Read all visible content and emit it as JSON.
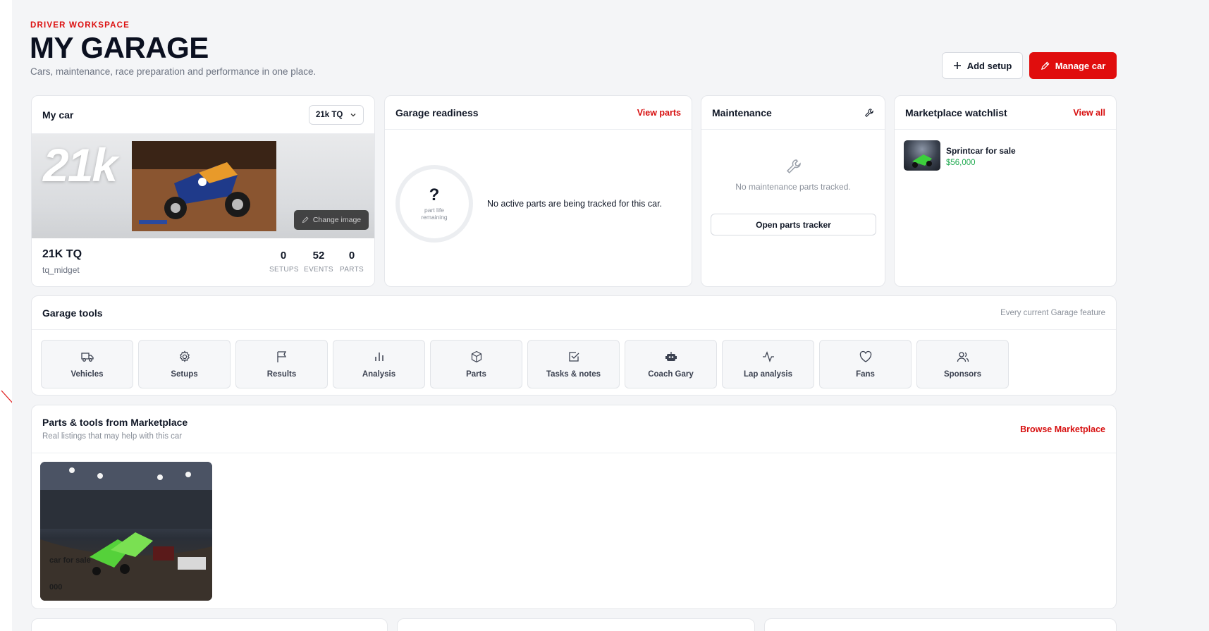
{
  "header": {
    "eyebrow": "DRIVER WORKSPACE",
    "title": "MY GARAGE",
    "subtitle": "Cars, maintenance, race preparation and performance in one place."
  },
  "actions": {
    "add_setup": "Add setup",
    "manage_car": "Manage car"
  },
  "my_car": {
    "title": "My car",
    "selected_car": "21k TQ",
    "hero_text": "21k",
    "change_image": "Change image",
    "name": "21K TQ",
    "slug": "tq_midget",
    "stats": [
      {
        "value": "0",
        "label": "SETUPS"
      },
      {
        "value": "52",
        "label": "EVENTS"
      },
      {
        "value": "0",
        "label": "PARTS"
      }
    ]
  },
  "readiness": {
    "title": "Garage readiness",
    "link": "View parts",
    "ring_value": "?",
    "ring_label_line1": "part life",
    "ring_label_line2": "remaining",
    "message": "No active parts are being tracked for this car."
  },
  "maintenance": {
    "title": "Maintenance",
    "empty_message": "No maintenance parts tracked.",
    "button": "Open parts tracker"
  },
  "watchlist": {
    "title": "Marketplace watchlist",
    "link": "View all",
    "item_name": "Sprintcar for sale",
    "item_price": "$56,000"
  },
  "tools": {
    "title": "Garage tools",
    "note": "Every current Garage feature",
    "items": [
      {
        "label": "Vehicles",
        "icon": "truck-icon"
      },
      {
        "label": "Setups",
        "icon": "gear-icon"
      },
      {
        "label": "Results",
        "icon": "flag-icon"
      },
      {
        "label": "Analysis",
        "icon": "bar-chart-icon"
      },
      {
        "label": "Parts",
        "icon": "package-icon"
      },
      {
        "label": "Tasks & notes",
        "icon": "checkbox-icon"
      },
      {
        "label": "Coach Gary",
        "icon": "robot-icon"
      },
      {
        "label": "Lap analysis",
        "icon": "activity-icon"
      },
      {
        "label": "Fans",
        "icon": "heart-icon"
      },
      {
        "label": "Sponsors",
        "icon": "users-icon"
      }
    ]
  },
  "marketplace": {
    "title": "Parts & tools from Marketplace",
    "subtitle": "Real listings that may help with this car",
    "link": "Browse Marketplace",
    "listing_name": "car for sale",
    "listing_price": "000"
  },
  "colors": {
    "accent": "#e00d0d",
    "price_green": "#1faa4f",
    "page_bg": "#f4f5f7"
  }
}
